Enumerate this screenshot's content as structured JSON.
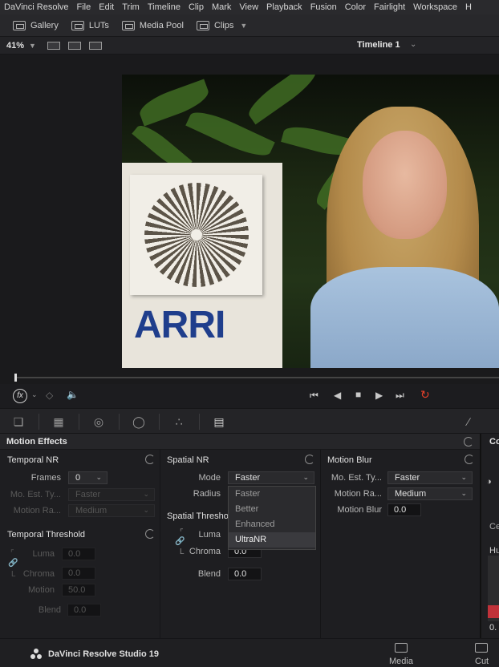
{
  "menubar": [
    "DaVinci Resolve",
    "File",
    "Edit",
    "Trim",
    "Timeline",
    "Clip",
    "Mark",
    "View",
    "Playback",
    "Fusion",
    "Color",
    "Fairlight",
    "Workspace",
    "H"
  ],
  "toolbar": {
    "gallery": "Gallery",
    "luts": "LUTs",
    "media_pool": "Media Pool",
    "clips": "Clips"
  },
  "viewer": {
    "zoom": "41%",
    "timeline_name": "Timeline 1"
  },
  "image": {
    "logo_text": "ARRI"
  },
  "panel": {
    "title": "Motion Effects",
    "right_tab_partial": "Co"
  },
  "temporal_nr": {
    "title": "Temporal NR",
    "frames_label": "Frames",
    "frames_value": "0",
    "mo_est_label": "Mo. Est. Ty...",
    "mo_est_value": "Faster",
    "motion_range_label": "Motion Ra...",
    "motion_range_value": "Medium"
  },
  "temporal_threshold": {
    "title": "Temporal Threshold",
    "luma_label": "Luma",
    "luma_value": "0.0",
    "chroma_label": "Chroma",
    "chroma_value": "0.0",
    "motion_label": "Motion",
    "motion_value": "50.0",
    "blend_label": "Blend",
    "blend_value": "0.0"
  },
  "spatial_nr": {
    "title": "Spatial NR",
    "mode_label": "Mode",
    "mode_value": "Faster",
    "radius_label": "Radius",
    "threshold_title": "Spatial Thresho",
    "luma_label": "Luma",
    "chroma_label": "Chroma",
    "chroma_value": "0.0",
    "blend_label": "Blend",
    "blend_value": "0.0",
    "mode_options": [
      "Faster",
      "Better",
      "Enhanced",
      "UltraNR"
    ],
    "highlighted_option": "UltraNR"
  },
  "motion_blur": {
    "title": "Motion Blur",
    "mo_est_label": "Mo. Est. Ty...",
    "mo_est_value": "Faster",
    "motion_range_label": "Motion Ra...",
    "motion_range_value": "Medium",
    "motion_blur_label": "Motion Blur",
    "motion_blur_value": "0.0"
  },
  "side_partial": {
    "ce": "Ce",
    "hu": "Hu",
    "zero": "0."
  },
  "footer": {
    "brand": "DaVinci Resolve Studio 19",
    "page_media": "Media",
    "page_cut": "Cut"
  },
  "colors": {
    "accent_red": "#e8402a",
    "background": "#1e1e21",
    "logo_blue": "#1f3e8c"
  }
}
